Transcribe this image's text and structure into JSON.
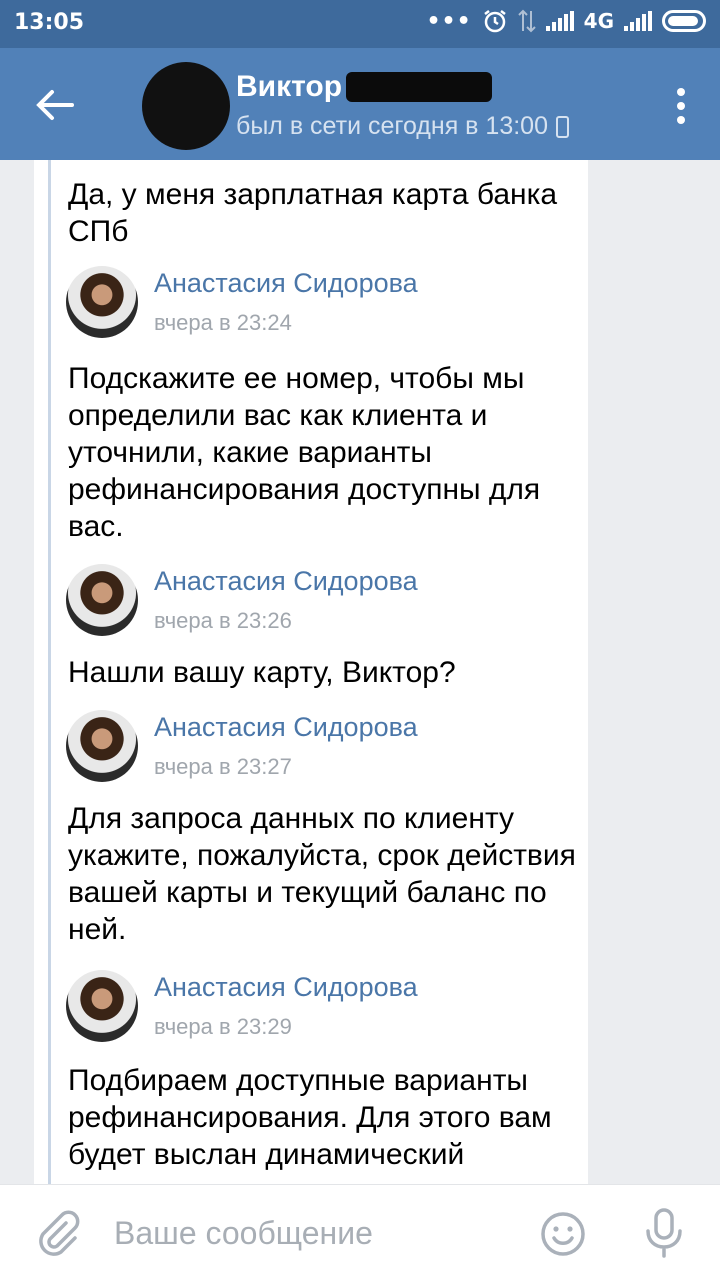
{
  "status_bar": {
    "time": "13:05",
    "network": "4G",
    "icons": [
      "more-dots-icon",
      "alarm-icon",
      "signal-icon",
      "battery-icon"
    ]
  },
  "header": {
    "name": "Виктор",
    "status": "был в сети сегодня в 13:00",
    "icons": [
      "back-arrow-icon",
      "phone-icon",
      "more-vertical-icon"
    ]
  },
  "messages": [
    {
      "text": "Да, у меня зарплатная карта банка СПб"
    },
    {
      "author": "Анастасия Сидорова",
      "date": "вчера в 23:24",
      "text": "Подскажите ее номер, чтобы мы определили вас как клиента и уточнили, какие варианты рефинансирования доступны для вас."
    },
    {
      "author": "Анастасия Сидорова",
      "date": "вчера в 23:26",
      "text": "Нашли вашу карту, Виктор?"
    },
    {
      "author": "Анастасия Сидорова",
      "date": "вчера в 23:27",
      "text": "Для запроса данных по клиенту укажите, пожалуйста, срок действия вашей карты и текущий баланс по ней."
    },
    {
      "author": "Анастасия Сидорова",
      "date": "вчера в 23:29",
      "text": "Подбираем доступные варианты рефинансирования. Для этого вам будет выслан динамический"
    }
  ],
  "composer": {
    "placeholder": "Ваше сообщение",
    "icons": [
      "paperclip-icon",
      "smile-icon",
      "microphone-icon"
    ]
  },
  "colors": {
    "header": "#5181b8",
    "status_bar": "#3e6a9c",
    "link": "#4a76a8"
  }
}
